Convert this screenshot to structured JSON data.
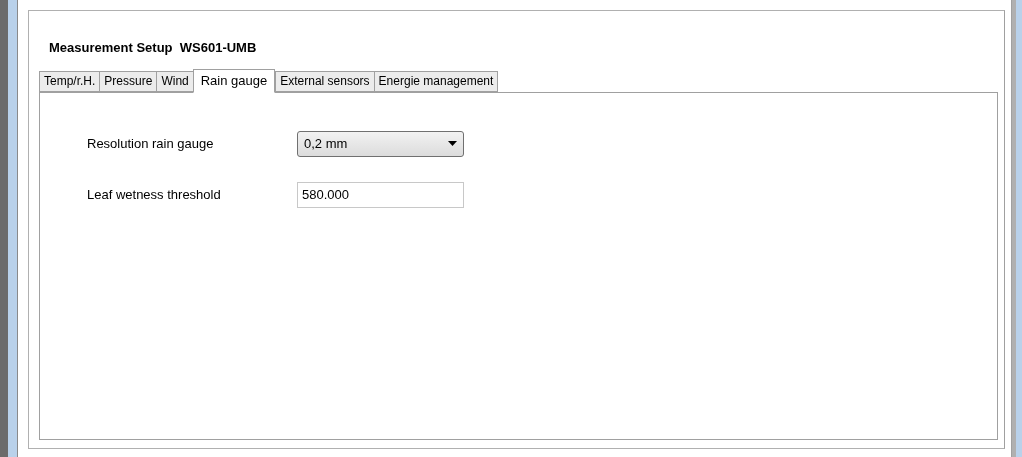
{
  "header": {
    "title": "Measurement Setup  WS601-UMB"
  },
  "tabs": [
    {
      "label": "Temp/r.H.",
      "selected": false
    },
    {
      "label": "Pressure",
      "selected": false
    },
    {
      "label": "Wind",
      "selected": false
    },
    {
      "label": "Rain gauge",
      "selected": true
    },
    {
      "label": "External sensors",
      "selected": false
    },
    {
      "label": "Energie management",
      "selected": false
    }
  ],
  "fields": [
    {
      "kind": "dropdown",
      "label": "Resolution rain gauge",
      "value": "0,2 mm"
    },
    {
      "kind": "text",
      "label": "Leaf wetness threshold",
      "value": "580.000"
    }
  ]
}
